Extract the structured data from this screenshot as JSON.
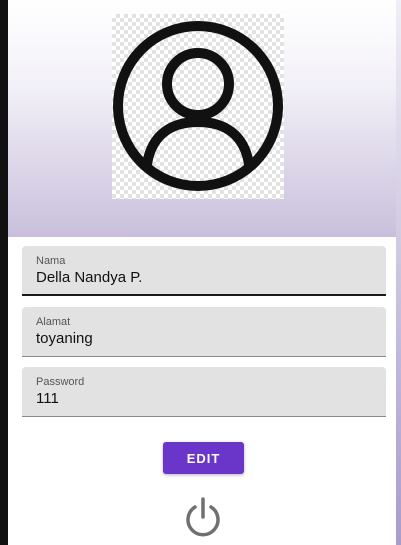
{
  "profile": {
    "avatar_icon": "account-circle-icon"
  },
  "form": {
    "nama": {
      "label": "Nama",
      "value": "Della Nandya P."
    },
    "alamat": {
      "label": "Alamat",
      "value": "toyaning"
    },
    "password": {
      "label": "Password",
      "value": "111"
    }
  },
  "actions": {
    "edit_label": "EDIT",
    "logout_icon": "power-icon"
  },
  "colors": {
    "accent": "#6a35c9",
    "field_bg": "#e2e2e2"
  }
}
